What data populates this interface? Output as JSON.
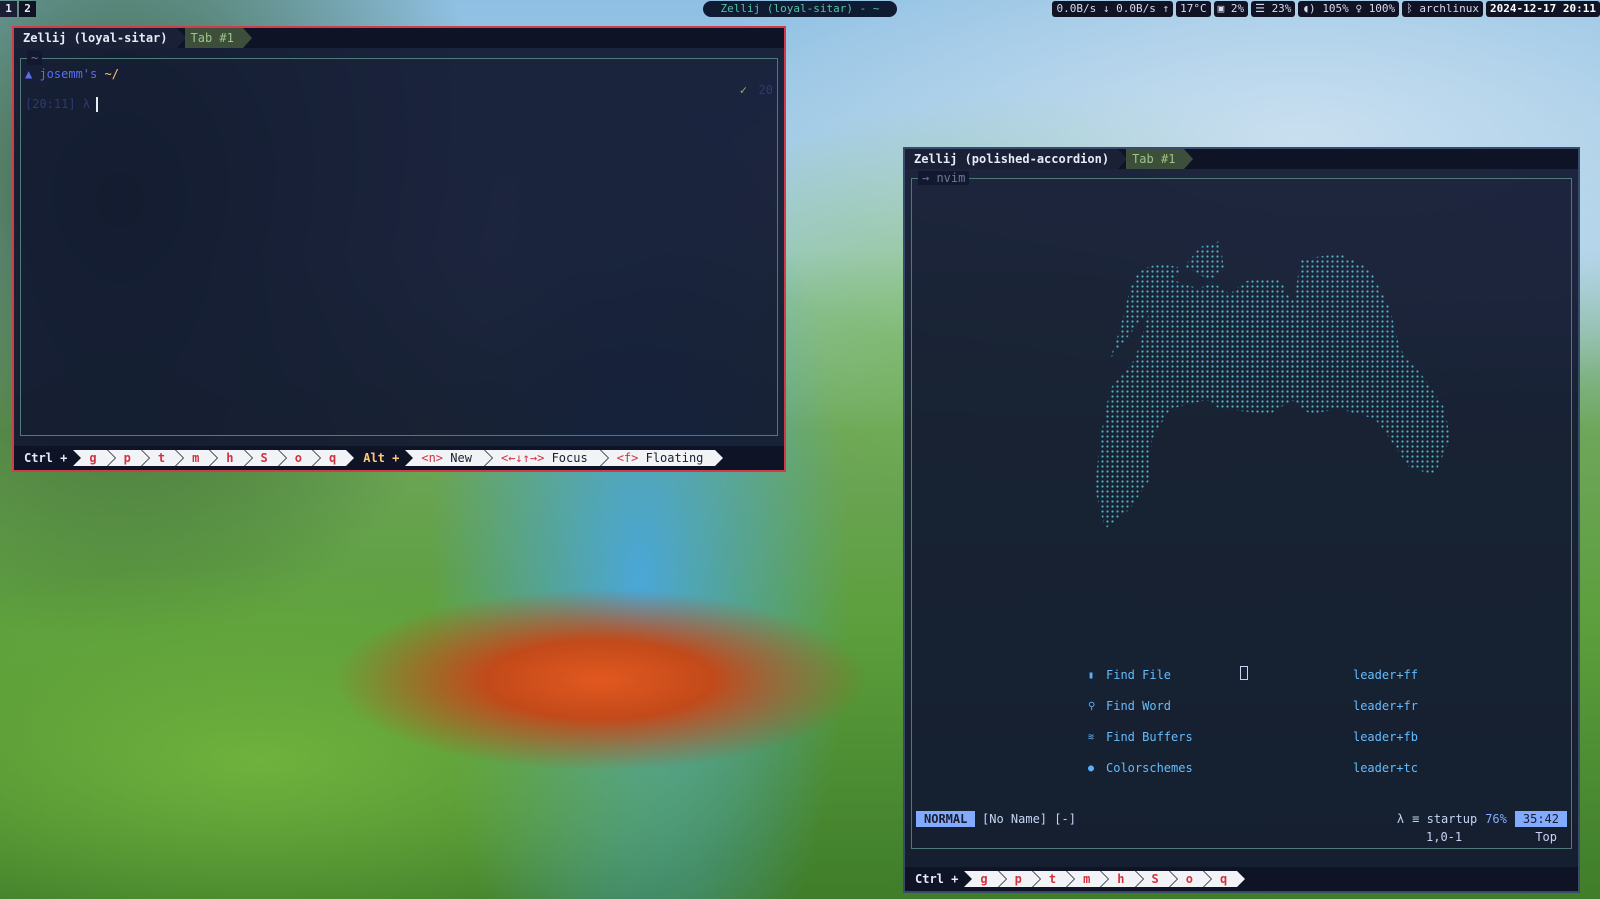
{
  "topbar": {
    "workspaces": [
      "1",
      "2"
    ],
    "window_title": "Zellij (loyal-sitar) - ~",
    "net": "0.0B/s ↓ 0.0B/s ↑",
    "temp": "17°C",
    "cpu": "2%",
    "mem": "23%",
    "volume": "105%",
    "mic": "100%",
    "host": "archlinux",
    "clock": "2024-12-17 20:11"
  },
  "win1": {
    "session": "Zellij (loyal-sitar)",
    "tab": "Tab #1",
    "pane_label": "~",
    "prompt_user": "josemm's",
    "prompt_dir": "~/",
    "prompt_line2": "[20:11] λ",
    "status_check": "✓",
    "status_num": "20"
  },
  "win2": {
    "session": "Zellij (polished-accordion)",
    "tab": "Tab #1",
    "pane_label": "→ nvim",
    "dashboard": [
      {
        "icon": "file-icon",
        "label": "Find File",
        "shortcut": "leader+ff"
      },
      {
        "icon": "search-icon",
        "label": "Find Word",
        "shortcut": "leader+fr"
      },
      {
        "icon": "buffers-icon",
        "label": "Find Buffers",
        "shortcut": "leader+fb"
      },
      {
        "icon": "palette-icon",
        "label": "Colorschemes",
        "shortcut": "leader+tc"
      }
    ],
    "mode": "NORMAL",
    "filename": "[No Name] [-]",
    "git_icon": "λ",
    "startup": "≡ startup",
    "percent": "76%",
    "time": "35:42",
    "cursor_pos": "1,0-1",
    "scroll_pos": "Top"
  },
  "hints": {
    "ctrl_label": "Ctrl +",
    "alt_label": "Alt +",
    "keys": [
      "g",
      "p",
      "t",
      "m",
      "h",
      "S",
      "o",
      "q"
    ],
    "new": {
      "key": "<n>",
      "label": "New"
    },
    "focus": {
      "key": "<←↓↑→>",
      "label": "Focus"
    },
    "floating": {
      "key": "<f>",
      "label": "Floating"
    }
  },
  "colors": {
    "active_border": "#d23b4a",
    "accent": "#82aaff",
    "logo_dots": "#4fb3c8"
  }
}
